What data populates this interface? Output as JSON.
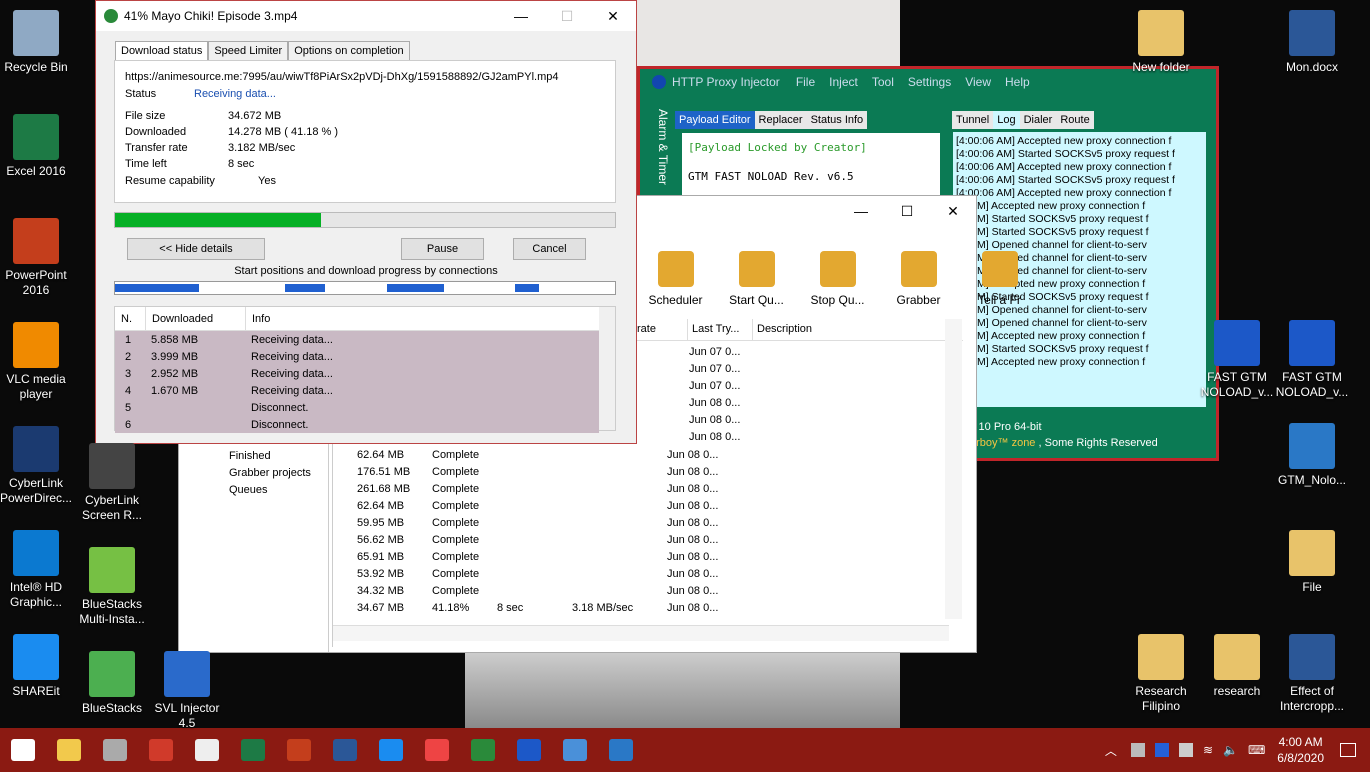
{
  "desktop": {
    "icons_left": [
      {
        "label": "Recycle Bin",
        "icon": "recycle-bin-icon"
      },
      {
        "label": "Excel 2016",
        "icon": "excel-icon"
      },
      {
        "label": "PowerPoint 2016",
        "icon": "powerpoint-icon"
      },
      {
        "label": "VLC media player",
        "icon": "vlc-icon"
      },
      {
        "label": "CyberLink PowerDirec...",
        "icon": "powerdirector-icon"
      },
      {
        "label": "Intel® HD Graphic...",
        "icon": "intel-icon"
      },
      {
        "label": "SHAREit",
        "icon": "shareit-icon"
      }
    ],
    "icons_col2": [
      {
        "label": "CyberLink Screen R...",
        "icon": "screenrecorder-icon"
      },
      {
        "label": "BlueStacks Multi-Insta...",
        "icon": "bluestacks-multi-icon"
      },
      {
        "label": "BlueStacks",
        "icon": "bluestacks-icon"
      }
    ],
    "icons_col3": [
      {
        "label": "SVL Injector 4.5",
        "icon": "svl-injector-icon"
      }
    ],
    "icons_right": [
      {
        "label": "New folder",
        "icon": "folder-icon"
      },
      {
        "label": "Mon.docx",
        "icon": "word-doc-icon"
      },
      {
        "label": "FAST GTM NOLOAD_v...",
        "icon": "hpi-file-icon"
      },
      {
        "label": "FAST GTM NOLOAD_v...",
        "icon": "hpi-file-icon"
      },
      {
        "label": "GTM_Nolo...",
        "icon": "ehi-file-icon"
      },
      {
        "label": "File",
        "icon": "file-icon"
      },
      {
        "label": "Research Filipino",
        "icon": "folder-icon"
      },
      {
        "label": "research",
        "icon": "folder-icon"
      },
      {
        "label": "Effect of Intercropp...",
        "icon": "word-doc-icon"
      }
    ]
  },
  "idm": {
    "title": "41% Mayo Chiki! Episode 3.mp4",
    "tabs": [
      "Download status",
      "Speed Limiter",
      "Options on completion"
    ],
    "url": "https://animesource.me:7995/au/wiwTf8PiArSx2pVDj-DhXg/1591588892/GJ2amPYl.mp4",
    "status_label": "Status",
    "status_value": "Receiving data...",
    "fields": [
      {
        "label": "File size",
        "value": "34.672  MB"
      },
      {
        "label": "Downloaded",
        "value": "14.278  MB  ( 41.18 % )"
      },
      {
        "label": "Transfer rate",
        "value": "3.182  MB/sec"
      },
      {
        "label": "Time left",
        "value": "8 sec"
      }
    ],
    "resume_label": "Resume capability",
    "resume_value": "Yes",
    "progress": 0.4118,
    "hide_btn": "<< Hide details",
    "pause_btn": "Pause",
    "cancel_btn": "Cancel",
    "conn_caption": "Start positions and download progress by connections",
    "conn_headers": [
      "N.",
      "Downloaded",
      "Info"
    ],
    "connections": [
      {
        "n": "1",
        "dl": "5.858  MB",
        "info": "Receiving data..."
      },
      {
        "n": "2",
        "dl": "3.999  MB",
        "info": "Receiving data..."
      },
      {
        "n": "3",
        "dl": "2.952  MB",
        "info": "Receiving data..."
      },
      {
        "n": "4",
        "dl": "1.670  MB",
        "info": "Receiving data..."
      },
      {
        "n": "5",
        "dl": "",
        "info": "Disconnect."
      },
      {
        "n": "6",
        "dl": "",
        "info": "Disconnect."
      }
    ]
  },
  "proxy": {
    "title": "HTTP Proxy Injector",
    "menu": [
      "File",
      "Inject",
      "Tool",
      "Settings",
      "View",
      "Help"
    ],
    "side_text": "Alarm & Timer",
    "left_tabs": [
      "Payload Editor",
      "Replacer",
      "Status Info"
    ],
    "payload_locked": "[Payload Locked by Creator]",
    "payload_line": "GTM FAST NOLOAD Rev. v6.5",
    "right_tabs": [
      "Tunnel",
      "Log",
      "Dialer",
      "Route"
    ],
    "log": [
      "[4:00:06 AM] Accepted new proxy connection f",
      "[4:00:06 AM] Started SOCKSv5 proxy request f",
      "[4:00:06 AM] Accepted new proxy connection f",
      "[4:00:06 AM] Started SOCKSv5 proxy request f",
      "[4:00:06 AM] Accepted new proxy connection f",
      "06 AM] Accepted new proxy connection f",
      "06 AM] Started SOCKSv5 proxy request f",
      "06 AM] Started SOCKSv5 proxy request f",
      "07 AM] Opened channel for client-to-serv",
      "07 AM] Opened channel for client-to-serv",
      "07 AM] Opened channel for client-to-serv",
      "07 AM] Accepted new proxy connection f",
      "07 AM] Started SOCKSv5 proxy request f",
      "07 AM] Opened channel for client-to-serv",
      "08 AM] Opened channel for client-to-serv",
      "08 AM] Accepted new proxy connection f",
      "08 AM] Started SOCKSv5 proxy request f",
      "08 AM] Accepted new proxy connection f"
    ],
    "os_text": "s 10 Pro 64-bit",
    "footer": "erboy™ zone",
    "footer2": ", Some Rights Reserved"
  },
  "idm_main": {
    "toolbar": [
      "Scheduler",
      "Start Qu...",
      "Stop Qu...",
      "Grabber",
      "Tell a Fr"
    ],
    "headers": [
      "rate",
      "Last Try...",
      "Description"
    ],
    "tree": [
      "Finished",
      "Grabber projects",
      "Queues"
    ],
    "top_dates": [
      "Jun 07 0...",
      "Jun 07 0...",
      "Jun 07 0...",
      "Jun 08 0...",
      "Jun 08 0...",
      "Jun 08 0..."
    ],
    "rows": [
      {
        "size": "62.64  MB",
        "status": "Complete",
        "time": "",
        "rate": "",
        "date": "Jun 08 0..."
      },
      {
        "size": "176.51  MB",
        "status": "Complete",
        "time": "",
        "rate": "",
        "date": "Jun 08 0..."
      },
      {
        "size": "261.68  MB",
        "status": "Complete",
        "time": "",
        "rate": "",
        "date": "Jun 08 0..."
      },
      {
        "size": "62.64  MB",
        "status": "Complete",
        "time": "",
        "rate": "",
        "date": "Jun 08 0..."
      },
      {
        "size": "59.95  MB",
        "status": "Complete",
        "time": "",
        "rate": "",
        "date": "Jun 08 0..."
      },
      {
        "size": "56.62  MB",
        "status": "Complete",
        "time": "",
        "rate": "",
        "date": "Jun 08 0..."
      },
      {
        "size": "65.91  MB",
        "status": "Complete",
        "time": "",
        "rate": "",
        "date": "Jun 08 0..."
      },
      {
        "size": "53.92  MB",
        "status": "Complete",
        "time": "",
        "rate": "",
        "date": "Jun 08 0..."
      },
      {
        "size": "34.32  MB",
        "status": "Complete",
        "time": "",
        "rate": "",
        "date": "Jun 08 0..."
      },
      {
        "size": "34.67  MB",
        "status": "41.18%",
        "time": "8 sec",
        "rate": "3.18  MB/sec",
        "date": "Jun 08 0..."
      }
    ]
  },
  "taskbar": {
    "time": "4:00 AM",
    "date": "6/8/2020",
    "apps": [
      "start-icon",
      "file-explorer-icon",
      "taskview-icon",
      "settings-app-icon",
      "store-icon",
      "excel-task-icon",
      "powerpoint-task-icon",
      "word-task-icon",
      "shareit-task-icon",
      "chrome-icon",
      "idm-task-icon",
      "hpi-task-icon",
      "network-task-icon",
      "ehi-task-icon"
    ]
  }
}
